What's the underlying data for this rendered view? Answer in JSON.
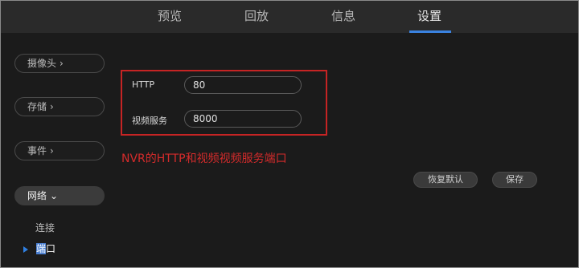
{
  "nav": {
    "tabs": [
      {
        "label": "预览"
      },
      {
        "label": "回放"
      },
      {
        "label": "信息"
      },
      {
        "label": "设置"
      }
    ],
    "active_tab": "设置"
  },
  "sidebar": {
    "items": [
      {
        "label": "摄像头",
        "chevron": "›"
      },
      {
        "label": "存储",
        "chevron": "›"
      },
      {
        "label": "事件",
        "chevron": "›"
      },
      {
        "label": "网络",
        "chevron": "⌄"
      }
    ],
    "sub_items": [
      {
        "label": "连接"
      },
      {
        "label_highlight": "端",
        "label_rest": "口"
      }
    ]
  },
  "form": {
    "http_label": "HTTP",
    "http_value": "80",
    "video_label": "视频服务",
    "video_value": "8000"
  },
  "annotation": "NVR的HTTP和视频视频服务端口",
  "buttons": {
    "restore_label": "恢复默认",
    "save_label": "保存"
  },
  "colors": {
    "accent": "#3a82e0",
    "highlight_box": "#c62424",
    "annotation_text": "#d42b2b"
  }
}
